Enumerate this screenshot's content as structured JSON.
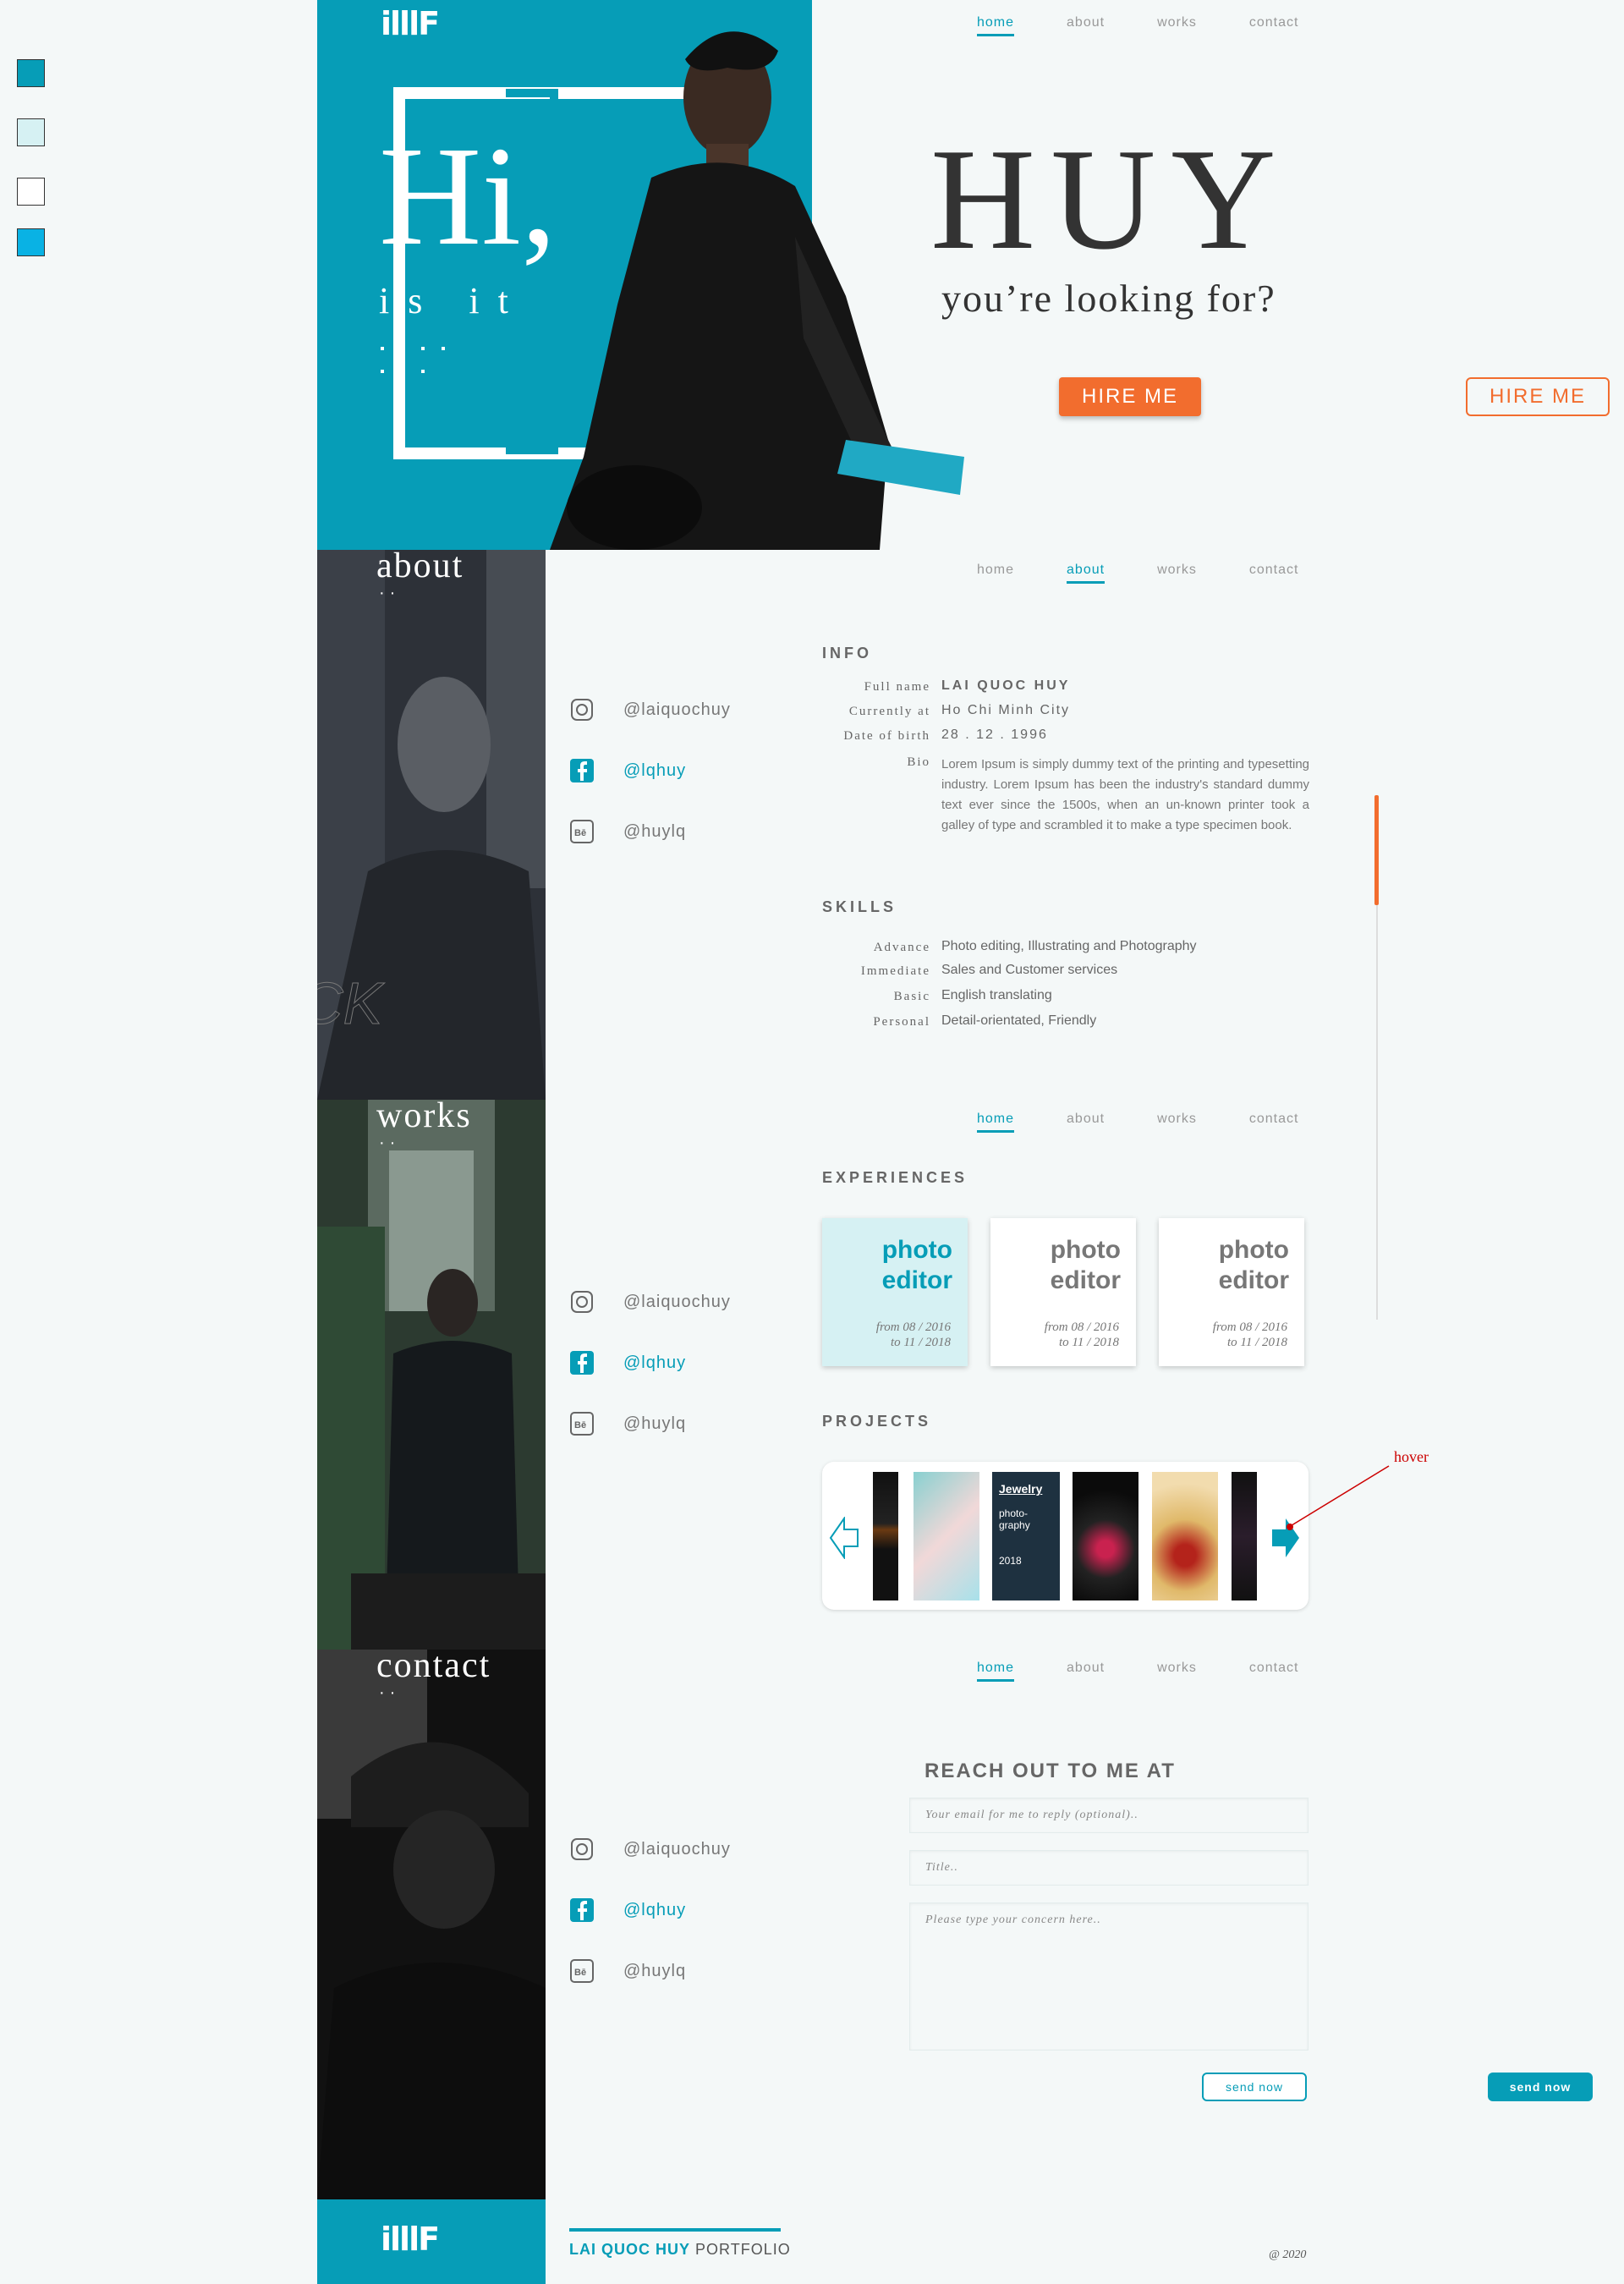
{
  "palette": {
    "teal": "#069db7",
    "light_teal": "#d6f1f3",
    "white": "#ffffff",
    "cyan": "#09b2e4",
    "orange": "#f26d2e"
  },
  "logo": "illlF",
  "hero": {
    "greeting": "Hi,",
    "is_it": "is it",
    "name": "HUY",
    "subtitle": "you’re looking for?",
    "hire_button": "HIRE ME",
    "hire_button_hover": "HIRE ME"
  },
  "nav": {
    "home": "home",
    "about": "about",
    "works": "works",
    "contact": "contact"
  },
  "sections": {
    "about": "about",
    "works": "works",
    "contact": "contact"
  },
  "social": {
    "instagram": "@laiquochuy",
    "facebook": "@lqhuy",
    "behance": "@huylq",
    "instagram_icon": "instagram-icon",
    "facebook_icon": "facebook-icon",
    "behance_icon": "behance-icon"
  },
  "info": {
    "heading": "INFO",
    "fullname_key": "Full name",
    "fullname_val": "LAI QUOC HUY",
    "current_key": "Currently at",
    "current_val": "Ho Chi Minh City",
    "dob_key": "Date of birth",
    "dob_val": "28 . 12 . 1996",
    "bio_key": "Bio",
    "bio_val": "Lorem Ipsum is simply dummy text of the printing and typesetting industry. Lorem Ipsum has been the industry's standard dummy text ever since the 1500s, when an un-known printer took a galley of type and scrambled it to make a type specimen book."
  },
  "skills": {
    "heading": "SKILLS",
    "items": [
      {
        "key": "Advance",
        "val": "Photo editing, Illustrating and Photography"
      },
      {
        "key": "Immediate",
        "val": "Sales and Customer services"
      },
      {
        "key": "Basic",
        "val": "English translating"
      },
      {
        "key": "Personal",
        "val": "Detail-orientated, Friendly"
      }
    ]
  },
  "experiences": {
    "heading": "EXPERIENCES",
    "cards": [
      {
        "line1": "photo",
        "line2": "editor",
        "from": "from 08 / 2016",
        "to": "to 11 / 2018"
      },
      {
        "line1": "photo",
        "line2": "editor",
        "from": "from 08 / 2016",
        "to": "to 11 / 2018"
      },
      {
        "line1": "photo",
        "line2": "editor",
        "from": "from 08 / 2016",
        "to": "to 11 / 2018"
      }
    ]
  },
  "projects": {
    "heading": "PROJECTS",
    "jewelry_title": "Jewelry",
    "jewelry_sub1": "photo-",
    "jewelry_sub2": "graphy",
    "jewelry_year": "2018",
    "hover_label": "hover"
  },
  "contact": {
    "heading": "REACH OUT TO ME AT",
    "email_placeholder": "Your email for me to reply (optional)..",
    "title_placeholder": "Title..",
    "message_placeholder": "Please type your concern here..",
    "send_button": "send now",
    "send_button_hover": "send now"
  },
  "footer": {
    "portfolio_prefix": "LAI QUOC HUY",
    "portfolio_suffix": " PORTFOLIO",
    "copyright": "@ 2020"
  }
}
